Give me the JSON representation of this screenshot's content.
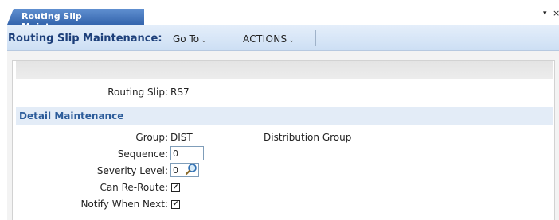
{
  "tab": {
    "label": "Routing Slip Maintenance",
    "menu_glyph": "▾",
    "close_glyph": "×"
  },
  "toolbar": {
    "title": "Routing Slip Maintenance:",
    "goto_label": "Go To",
    "actions_label": "ACTIONS",
    "chevron": "⌄"
  },
  "header": {
    "routing_slip_label": "Routing Slip:",
    "routing_slip_value": "RS7"
  },
  "section": {
    "title": "Detail Maintenance"
  },
  "fields": {
    "group_label": "Group:",
    "group_value": "DIST",
    "group_description": "Distribution Group",
    "sequence_label": "Sequence:",
    "sequence_value": "0",
    "severity_label": "Severity Level:",
    "severity_value": "0",
    "can_reroute_label": "Can Re-Route:",
    "can_reroute_checked": true,
    "notify_label": "Notify When Next:",
    "notify_checked": true
  },
  "icons": {
    "lookup": "magnifier-icon",
    "check_glyph": "✔"
  },
  "colors": {
    "tab_blue": "#3565ad",
    "toolbar_title": "#1d3f7a",
    "section_title": "#2c5c9a"
  }
}
